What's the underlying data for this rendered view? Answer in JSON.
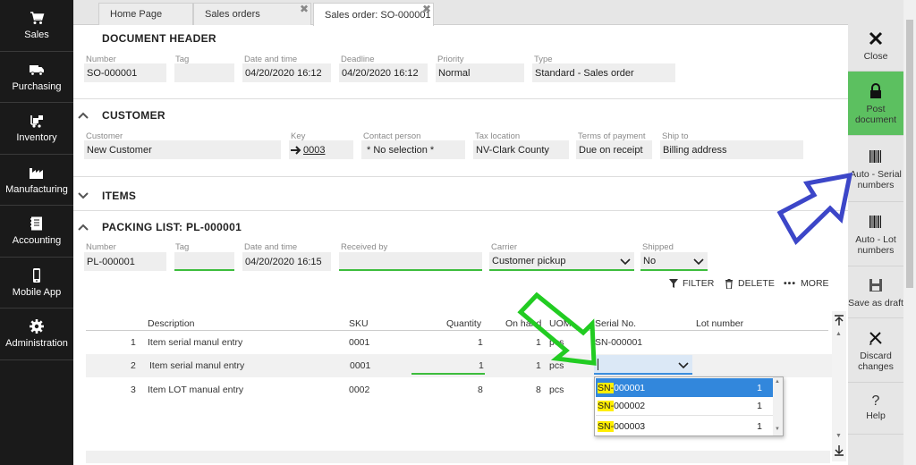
{
  "nav": {
    "items": [
      {
        "label": "Sales",
        "icon": "cart-icon"
      },
      {
        "label": "Purchasing",
        "icon": "truck-icon"
      },
      {
        "label": "Inventory",
        "icon": "forklift-icon"
      },
      {
        "label": "Manufacturing",
        "icon": "factory-icon"
      },
      {
        "label": "Accounting",
        "icon": "ledger-icon"
      },
      {
        "label": "Mobile App",
        "icon": "phone-icon"
      },
      {
        "label": "Administration",
        "icon": "gear-icon"
      }
    ]
  },
  "tabs": [
    {
      "label": "Home Page"
    },
    {
      "label": "Sales orders"
    },
    {
      "label": "Sales order: SO-000001"
    }
  ],
  "document_header": {
    "title": "DOCUMENT HEADER",
    "number_label": "Number",
    "number": "SO-000001",
    "tag_label": "Tag",
    "tag": "",
    "datetime_label": "Date and time",
    "datetime": "04/20/2020 16:12",
    "deadline_label": "Deadline",
    "deadline": "04/20/2020 16:12",
    "priority_label": "Priority",
    "priority": "Normal",
    "type_label": "Type",
    "type": "Standard - Sales order"
  },
  "customer": {
    "title": "CUSTOMER",
    "customer_label": "Customer",
    "customer": "New Customer",
    "key_label": "Key",
    "key": "0003",
    "contact_label": "Contact person",
    "contact": "* No selection *",
    "tax_label": "Tax location",
    "tax": "NV-Clark County",
    "terms_label": "Terms of payment",
    "terms": "Due on receipt",
    "shipto_label": "Ship to",
    "shipto": "Billing address"
  },
  "items": {
    "title": "ITEMS"
  },
  "packing": {
    "title": "PACKING LIST: PL-000001",
    "number_label": "Number",
    "number": "PL-000001",
    "tag_label": "Tag",
    "tag": "",
    "datetime_label": "Date and time",
    "datetime": "04/20/2020 16:15",
    "received_label": "Received by",
    "received": "",
    "carrier_label": "Carrier",
    "carrier": "Customer pickup",
    "shipped_label": "Shipped",
    "shipped": "No"
  },
  "toolbar": {
    "filter": "FILTER",
    "delete": "DELETE",
    "more": "MORE"
  },
  "table": {
    "headers": {
      "description": "Description",
      "sku": "SKU",
      "quantity": "Quantity",
      "onhand": "On hand",
      "uom": "UOM",
      "serial": "Serial No.",
      "lot": "Lot number"
    },
    "rows": [
      {
        "num": "1",
        "description": "Item serial manul entry",
        "sku": "0001",
        "quantity": "1",
        "onhand": "1",
        "uom": "pcs",
        "serial": "SN-000001"
      },
      {
        "num": "2",
        "description": "Item serial manul entry",
        "sku": "0001",
        "quantity": "1",
        "onhand": "1",
        "uom": "pcs",
        "serial": ""
      },
      {
        "num": "3",
        "description": "Item LOT manual entry",
        "sku": "0002",
        "quantity": "8",
        "onhand": "8",
        "uom": "pcs",
        "serial": ""
      }
    ]
  },
  "dropdown": {
    "items": [
      {
        "prefix": "SN-",
        "rest": "000001",
        "count": "1"
      },
      {
        "prefix": "SN-",
        "rest": "000002",
        "count": "1"
      },
      {
        "prefix": "SN-",
        "rest": "000003",
        "count": "1"
      }
    ]
  },
  "right_panel": {
    "close": "Close",
    "post": "Post document",
    "auto_serial": "Auto - Serial numbers",
    "auto_lot": "Auto - Lot numbers",
    "save_draft": "Save as draft",
    "discard": "Discard changes",
    "help": "Help",
    "help_glyph": "?"
  },
  "colors": {
    "accent_green": "#5cc060",
    "select_blue": "#3287dc",
    "arrow_blue": "#3c46c8",
    "arrow_green": "#22cc22",
    "highlight": "#ffee00"
  }
}
